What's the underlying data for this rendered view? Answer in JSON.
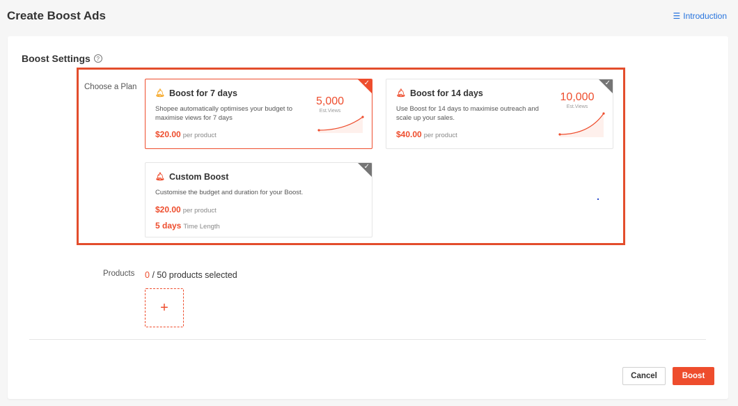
{
  "header": {
    "title": "Create Boost Ads",
    "intro_icon": "☰",
    "intro_label": "Introduction"
  },
  "settings": {
    "title": "Boost Settings",
    "help_icon": "?",
    "choose_plan_label": "Choose a Plan"
  },
  "plans": [
    {
      "name": "Boost for 7 days",
      "description": "Shopee automatically optimises your budget to maximise views for 7 days",
      "price": "$20.00",
      "price_unit": "per product",
      "views": "5,000",
      "views_label": "Est.Views",
      "selected": true
    },
    {
      "name": "Boost for 14 days",
      "description": "Use Boost for 14 days to maximise outreach and scale up your sales.",
      "price": "$40.00",
      "price_unit": "per product",
      "views": "10,000",
      "views_label": "Est.Views",
      "selected": false
    },
    {
      "name": "Custom Boost",
      "description": "Customise the budget and duration for your Boost.",
      "price": "$20.00",
      "price_unit": "per product",
      "duration": "5 days",
      "duration_label": "Time Length",
      "selected": false
    }
  ],
  "products": {
    "label": "Products",
    "selected_count": "0",
    "total_text": "/ 50 products selected",
    "add_icon": "+"
  },
  "actions": {
    "cancel_label": "Cancel",
    "boost_label": "Boost"
  },
  "colors": {
    "accent": "#ee4d2d",
    "link": "#2673dd",
    "frame": "#e34d2c"
  }
}
